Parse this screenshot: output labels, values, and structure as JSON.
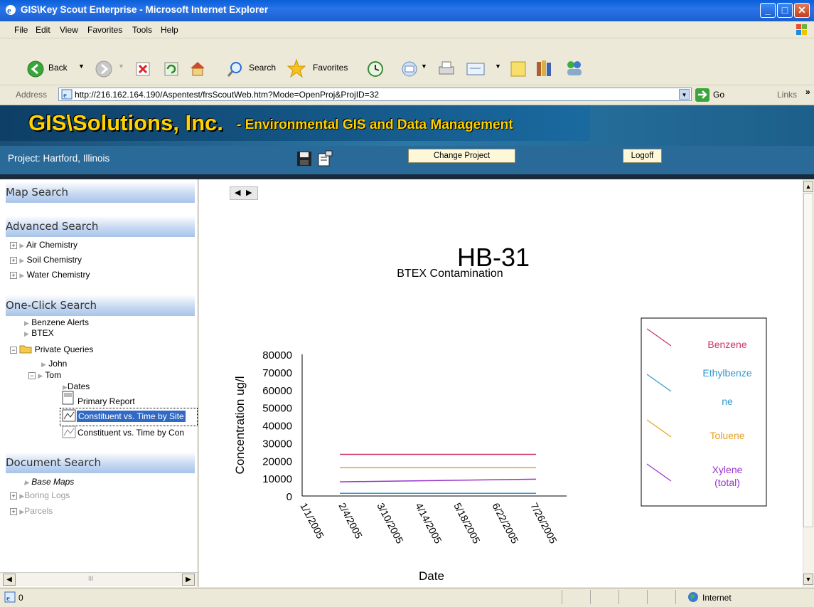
{
  "window": {
    "title": "GIS\\Key Scout Enterprise - Microsoft Internet Explorer"
  },
  "menu": [
    "File",
    "Edit",
    "View",
    "Favorites",
    "Tools",
    "Help"
  ],
  "toolbar": {
    "back_label": "Back",
    "search_label": "Search",
    "favorites_label": "Favorites"
  },
  "address": {
    "label": "Address",
    "url": "http://216.162.164.190/Aspentest/frsScoutWeb.htm?Mode=OpenProj&ProjID=32",
    "go_label": "Go",
    "links_label": "Links"
  },
  "banner": {
    "company": "GIS\\Solutions, Inc.",
    "tagline": "- Environmental GIS and Data Management",
    "project": "Project: Hartford, Illinois",
    "change_project": "Change Project",
    "logoff": "Logoff"
  },
  "left": {
    "map_search": "Map Search",
    "advanced_search": "Advanced Search",
    "advanced_items": [
      "Air Chemistry",
      "Soil Chemistry",
      "Water Chemistry"
    ],
    "one_click": "One-Click Search",
    "one_click_items": [
      "Benzene Alerts",
      "BTEX"
    ],
    "private_queries": "Private Queries",
    "john": "John",
    "tom": "Tom",
    "dates": "Dates",
    "primary_report": "Primary Report",
    "const_site": "Constituent vs. Time by Site",
    "const_com": "Constituent vs. Time by Con",
    "document_search": "Document Search",
    "doc_items": [
      "Base Maps",
      "Boring Logs",
      "Parcels"
    ],
    "scroll_mid": "III"
  },
  "status": {
    "left": "0",
    "zone": "Internet"
  },
  "chart_data": {
    "type": "line",
    "title": "HB-31",
    "subtitle": "BTEX Contamination",
    "xlabel": "Date",
    "ylabel": "Concentration ug/l",
    "x": [
      "1/1/2005",
      "2/4/2005",
      "3/10/2005",
      "4/14/2005",
      "5/18/2005",
      "6/22/2005",
      "7/26/2005"
    ],
    "yticks": [
      0,
      10000,
      20000,
      30000,
      40000,
      50000,
      60000,
      70000,
      80000
    ],
    "ylim": [
      0,
      80000
    ],
    "legend_position": "right",
    "series": [
      {
        "name": "Benzene",
        "color": "#cc3366",
        "start": "2/4/2005",
        "end": "7/26/2005",
        "values": [
          23500,
          23500
        ]
      },
      {
        "name": "Ethylbenze ne",
        "color": "#3399cc",
        "start": "2/4/2005",
        "end": "7/26/2005",
        "values": [
          1500,
          1500
        ]
      },
      {
        "name": "Toluene",
        "color": "#e8a020",
        "start": "2/4/2005",
        "end": "7/26/2005",
        "values": [
          16000,
          16000
        ]
      },
      {
        "name": "Xylene (total)",
        "color": "#9933cc",
        "start": "2/4/2005",
        "end": "7/26/2005",
        "values": [
          8000,
          9500
        ]
      }
    ]
  }
}
